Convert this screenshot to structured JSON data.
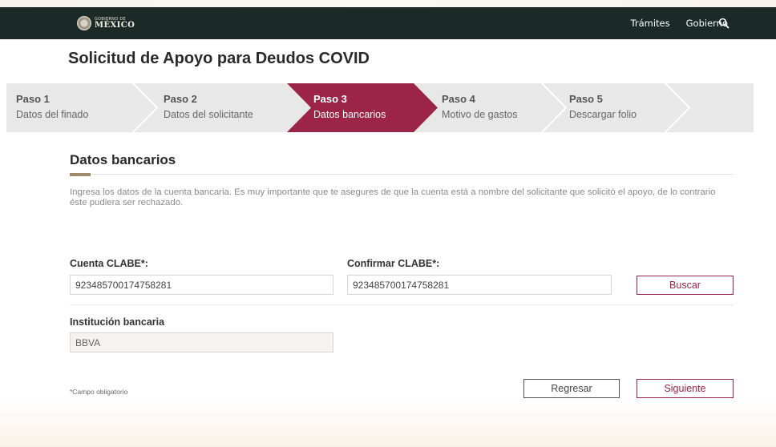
{
  "header": {
    "logo_small": "GOBIERNO DE",
    "logo_big": "MÉXICO",
    "nav": [
      "Trámites",
      "Gobierno"
    ],
    "search_icon": "search-icon"
  },
  "page_title": "Solicitud de Apoyo para Deudos COVID",
  "steps": [
    {
      "title": "Paso 1",
      "subtitle": "Datos del finado"
    },
    {
      "title": "Paso 2",
      "subtitle": "Datos del solicitante"
    },
    {
      "title": "Paso 3",
      "subtitle": "Datos bancarios"
    },
    {
      "title": "Paso 4",
      "subtitle": "Motivo de gastos"
    },
    {
      "title": "Paso 5",
      "subtitle": "Descargar folio"
    }
  ],
  "active_step": 3,
  "section": {
    "title": "Datos bancarios",
    "intro": "Ingresa los datos de la cuenta bancaria. Es muy importante que te asegures de que la cuenta está a nombre del solicitante que solicitó el apoyo, de lo contrario éste pudiera ser rechazado."
  },
  "form": {
    "clabe_label": "Cuenta CLABE*:",
    "clabe_value": "923485700174758281",
    "confirm_label": "Confirmar CLABE*:",
    "confirm_value": "923485700174758281",
    "search_button": "Buscar",
    "bank_label": "Institución bancaria",
    "bank_value": "BBVA"
  },
  "footer": {
    "required_note": "*Campo obligatorio",
    "back_button": "Regresar",
    "next_button": "Siguiente"
  },
  "colors": {
    "accent": "#9d2449",
    "navbar": "#1b2a26",
    "step_inactive": "#e8e8e8",
    "gold": "#a0886b"
  }
}
